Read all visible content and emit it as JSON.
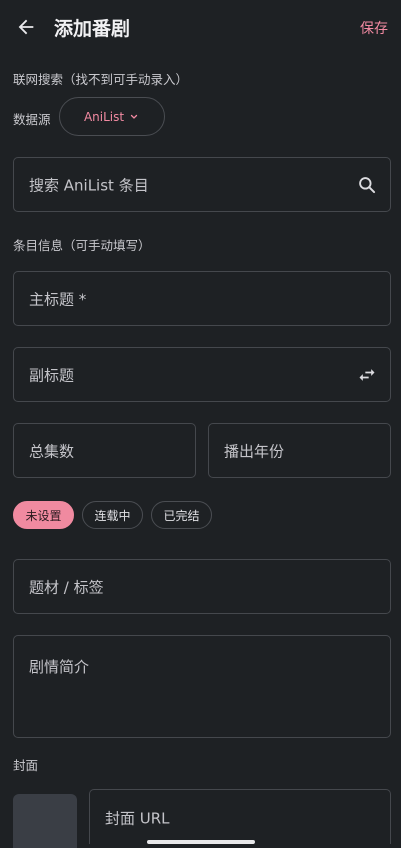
{
  "appbar": {
    "title": "添加番剧",
    "save_label": "保存",
    "back_icon": "arrow-left-icon"
  },
  "online_search": {
    "section_label": "联网搜索（找不到可手动录入）",
    "data_source_label": "数据源",
    "data_source_value": "AniList",
    "search_placeholder": "搜索 AniList 条目"
  },
  "entry_info": {
    "section_label": "条目信息（可手动填写）",
    "title_placeholder": "主标题 *",
    "subtitle_placeholder": "副标题",
    "episodes_placeholder": "总集数",
    "year_placeholder": "播出年份",
    "status_options": [
      "未设置",
      "连载中",
      "已完结"
    ],
    "selected_status": "未设置",
    "tags_placeholder": "题材 / 标签",
    "synopsis_placeholder": "剧情简介"
  },
  "cover": {
    "section_label": "封面",
    "url_placeholder": "封面 URL"
  },
  "colors": {
    "background": "#1e2124",
    "accent": "#f28aa2",
    "border": "#45484d"
  }
}
